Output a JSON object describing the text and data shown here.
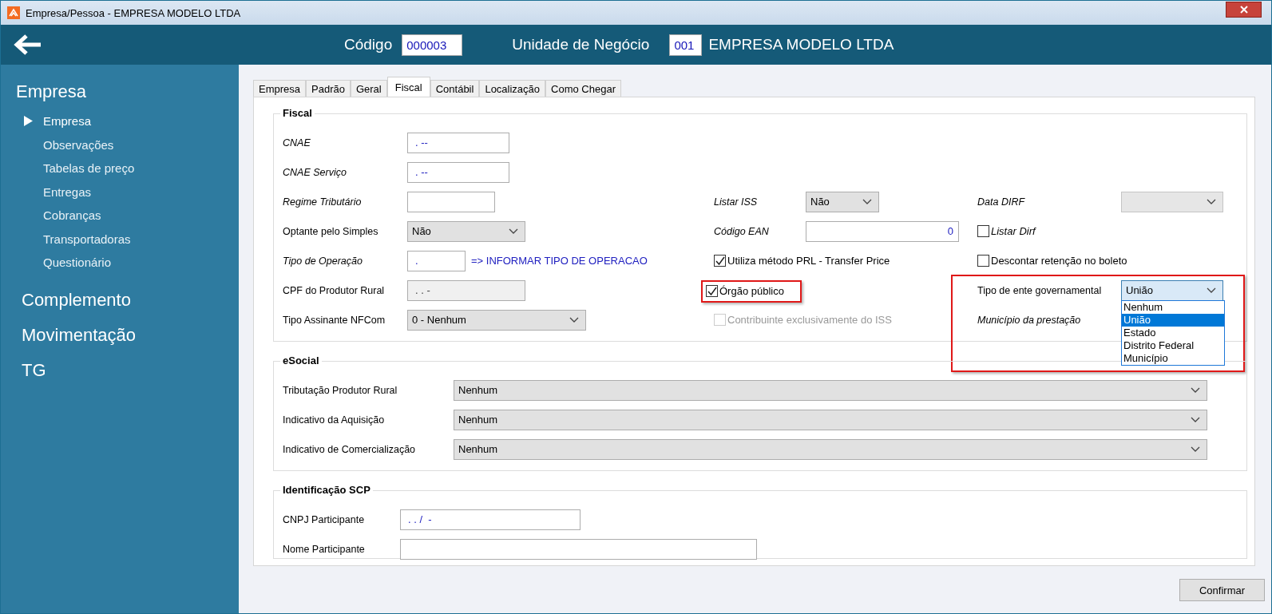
{
  "window": {
    "title": "Empresa/Pessoa - EMPRESA MODELO LTDA"
  },
  "header": {
    "codigo_label": "Código",
    "codigo": "000003",
    "unidade_label": "Unidade de Negócio",
    "unidade_code": "001",
    "unidade_name": "EMPRESA MODELO LTDA"
  },
  "sidebar": {
    "sections": [
      {
        "label": "Empresa",
        "children": [
          {
            "label": "Empresa",
            "selected": true
          },
          {
            "label": "Observações",
            "selected": false
          },
          {
            "label": "Tabelas de preço",
            "selected": false
          },
          {
            "label": "Entregas",
            "selected": false
          },
          {
            "label": "Cobranças",
            "selected": false
          },
          {
            "label": "Transportadoras",
            "selected": false
          },
          {
            "label": "Questionário",
            "selected": false
          }
        ]
      },
      {
        "label": "Complemento"
      },
      {
        "label": "Movimentação"
      },
      {
        "label": "TG"
      }
    ]
  },
  "tabs": [
    {
      "label": "Empresa",
      "selected": false
    },
    {
      "label": "Padrão",
      "selected": false
    },
    {
      "label": "Geral",
      "selected": false
    },
    {
      "label": "Fiscal",
      "selected": true
    },
    {
      "label": "Contábil",
      "selected": false
    },
    {
      "label": "Localização",
      "selected": false
    },
    {
      "label": "Como Chegar",
      "selected": false
    }
  ],
  "fiscal": {
    "title": "Fiscal",
    "rows": [
      {
        "left": {
          "kind": "input",
          "label": "CNAE",
          "italic": true,
          "value": ". --"
        }
      },
      {
        "left": {
          "kind": "input",
          "label": "CNAE Serviço",
          "italic": true,
          "value": ". --"
        }
      },
      {
        "left": {
          "kind": "input",
          "label": "Regime Tributário",
          "italic": true
        },
        "middle": {
          "kind": "select",
          "label": "Listar  ISS",
          "italic": true,
          "value": "Não"
        },
        "right": {
          "kind": "select",
          "label": "Data DIRF",
          "italic": true,
          "disabled": true
        }
      },
      {
        "left": {
          "kind": "select",
          "label": "Optante pelo Simples",
          "value": "Não"
        },
        "middle": {
          "kind": "input",
          "label": "Código EAN",
          "italic": true,
          "value": "0"
        },
        "right": {
          "kind": "checkbox",
          "label": "Listar Dirf",
          "italic": true,
          "checked": false
        }
      },
      {
        "left": {
          "kind": "input",
          "label": "Tipo de Operação",
          "italic": true,
          "value": ".",
          "note": "=> INFORMAR TIPO DE OPERACAO"
        },
        "middle": {
          "kind": "checkbox",
          "label": "Utiliza método PRL - Transfer Price",
          "checked": true
        },
        "right": {
          "kind": "checkbox",
          "label": "Descontar retenção no boleto",
          "checked": false
        }
      },
      {
        "left": {
          "kind": "input",
          "label": "CPF do Produtor Rural",
          "value": ". . -",
          "disabled": true
        },
        "middle": {
          "kind": "checkbox",
          "label": "Órgão público",
          "checked": true,
          "highlighted": true
        },
        "right": {
          "kind": "select",
          "label": "Tipo de ente governamental",
          "value": "União",
          "focused": true,
          "highlighted": true,
          "open": true,
          "options": [
            {
              "label": "Nenhum",
              "selected": false
            },
            {
              "label": "União",
              "selected": true
            },
            {
              "label": "Estado",
              "selected": false
            },
            {
              "label": "Distrito Federal",
              "selected": false
            },
            {
              "label": "Município",
              "selected": false
            }
          ]
        }
      },
      {
        "left": {
          "kind": "select",
          "label": "Tipo Assinante NFCom",
          "value": "0 - Nenhum"
        },
        "middle": {
          "kind": "checkbox",
          "label": "Contribuinte exclusivamente do ISS",
          "checked": false,
          "disabled": true
        },
        "right": {
          "kind": "label",
          "label": "Município da prestação",
          "italic": true
        }
      }
    ]
  },
  "esocial": {
    "title": "eSocial",
    "rows": [
      {
        "label": "Tributação Produtor Rural",
        "value": "Nenhum"
      },
      {
        "label": "Indicativo da Aquisição",
        "value": "Nenhum"
      },
      {
        "label": "Indicativo de Comercialização",
        "value": "Nenhum"
      }
    ]
  },
  "scp": {
    "title": "Identificação SCP",
    "rows": [
      {
        "label": "CNPJ Participante",
        "value": ". . /  -"
      },
      {
        "label": "Nome Participante"
      }
    ]
  },
  "confirm_button": "Confirmar"
}
